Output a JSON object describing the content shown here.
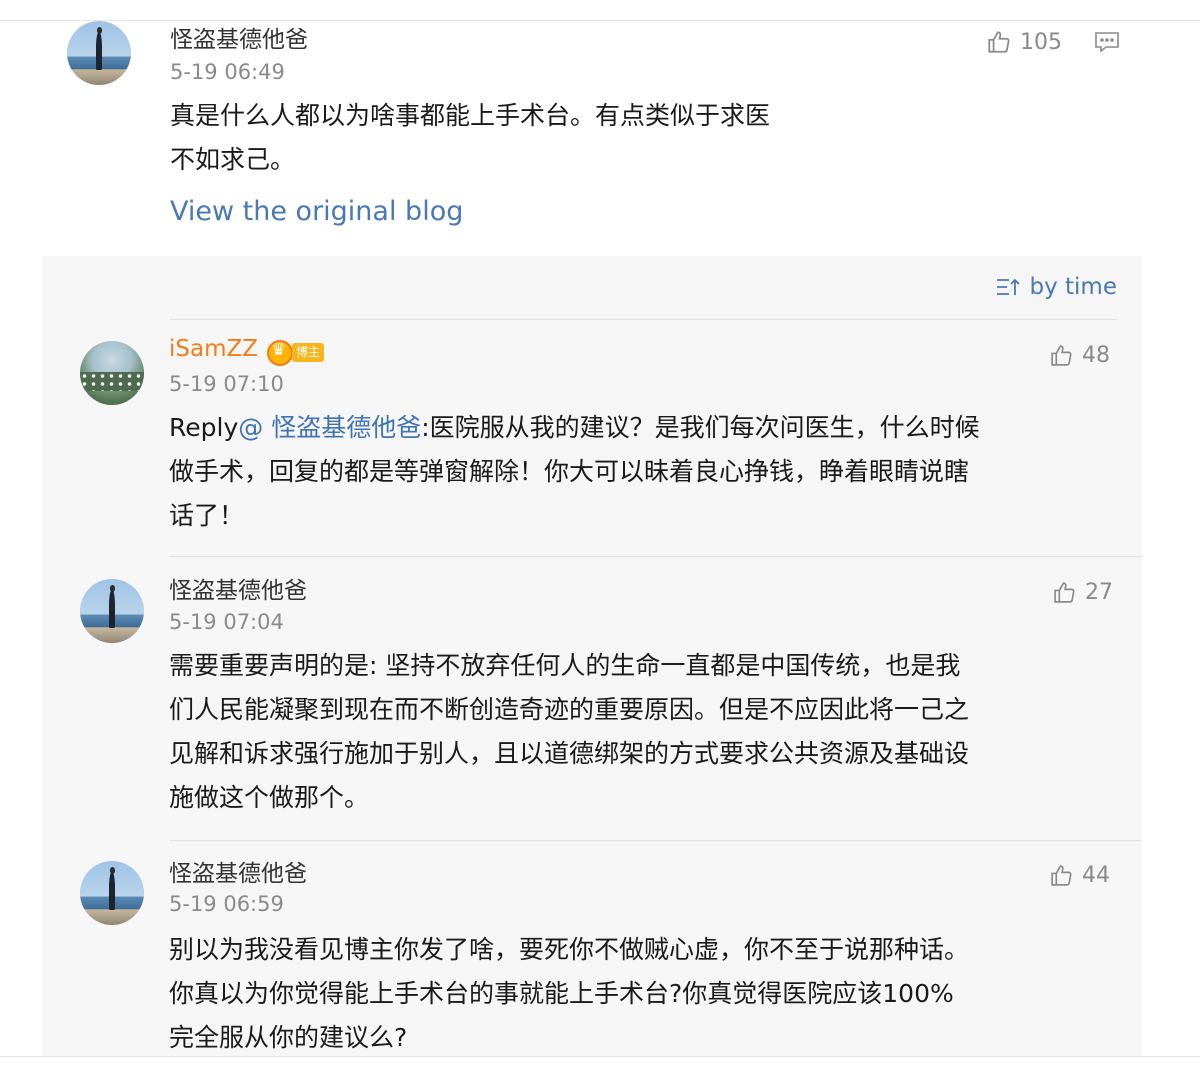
{
  "main_comment": {
    "user": "怪盗基德他爸",
    "time": "5-19 06:49",
    "likes": "105",
    "text_line1": "真是什么人都以为啥事都能上手术台。有点类似于求医",
    "text_line2": "不如求己。",
    "view_original": "View the original blog",
    "comment_icon": "comment-bubble-icon"
  },
  "replies": {
    "sort_label": "by time",
    "sort_icon": "sort-by-time-icon",
    "items": [
      {
        "user": "iSamZZ",
        "badge": "博主",
        "time": "5-19 07:10",
        "likes": "48",
        "reply_prefix": "Reply",
        "mention": "@ 怪盗基德他爸",
        "line1_rest": ":医院服从我的建议？是我们每次问医生，什么时候",
        "line2": "做手术，回复的都是等弹窗解除！你大可以昧着良心挣钱，睁着眼睛说瞎",
        "line3": "话了！"
      },
      {
        "user": "怪盗基德他爸",
        "time": "5-19 07:04",
        "likes": "27",
        "line1": "需要重要声明的是: 坚持不放弃任何人的生命一直都是中国传统，也是我",
        "line2": "们人民能凝聚到现在而不断创造奇迹的重要原因。但是不应因此将一己之",
        "line3": "见解和诉求强行施加于别人，且以道德绑架的方式要求公共资源及基础设",
        "line4": "施做这个做那个。"
      },
      {
        "user": "怪盗基德他爸",
        "time": "5-19 06:59",
        "likes": "44",
        "line1": "别以为我没看见博主你发了啥，要死你不做贼心虚，你不至于说那种话。",
        "line2": "你真以为你觉得能上手术台的事就能上手术台?你真觉得医院应该100%",
        "line3": "完全服从你的建议么?"
      }
    ]
  },
  "colors": {
    "link": "#4a78b5",
    "username_orange": "#f07d1a",
    "timestamp": "#8a8a8a",
    "reply_background": "#f6f6f6"
  }
}
